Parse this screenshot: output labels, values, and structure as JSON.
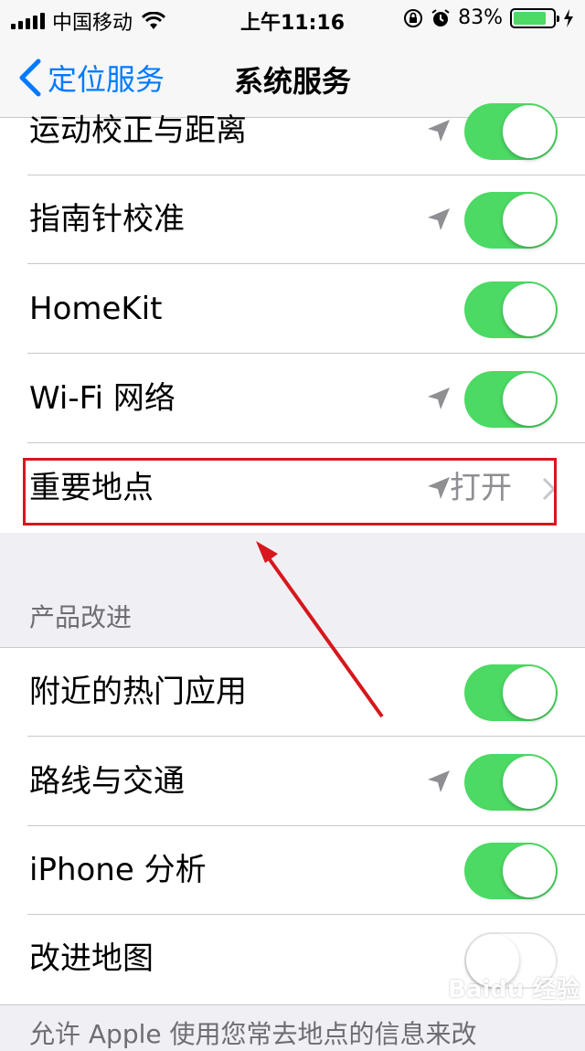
{
  "status_bar": {
    "carrier": "中国移动",
    "time": "上午11:16",
    "battery_percent": "83%",
    "battery_level": 0.83,
    "icons": [
      "signal-icon",
      "wifi-icon",
      "rotation-lock-icon",
      "alarm-icon",
      "battery-icon",
      "charging-icon"
    ]
  },
  "nav": {
    "back_label": "定位服务",
    "title": "系统服务"
  },
  "rows_top": [
    {
      "label": "运动校正与距离",
      "toggle": "on",
      "location_arrow": true
    },
    {
      "label": "指南针校准",
      "toggle": "on",
      "location_arrow": true
    },
    {
      "label": "HomeKit",
      "toggle": "on",
      "location_arrow": false
    },
    {
      "label": "Wi-Fi 网络",
      "toggle": "on",
      "location_arrow": true
    },
    {
      "label": "重要地点",
      "detail": "打开",
      "location_arrow": true
    }
  ],
  "section_header": "产品改进",
  "rows_bottom": [
    {
      "label": "附近的热门应用",
      "toggle": "on",
      "location_arrow": false
    },
    {
      "label": "路线与交通",
      "toggle": "on",
      "location_arrow": true
    },
    {
      "label": "iPhone 分析",
      "toggle": "on",
      "location_arrow": false
    },
    {
      "label": "改进地图",
      "toggle": "off",
      "location_arrow": false
    }
  ],
  "footer": "允许 Apple 使用您常去地点的信息来改",
  "watermark": "Baidu 经验",
  "colors": {
    "accent": "#007aff",
    "toggle_on": "#4cd964",
    "highlight": "#d6171c"
  }
}
